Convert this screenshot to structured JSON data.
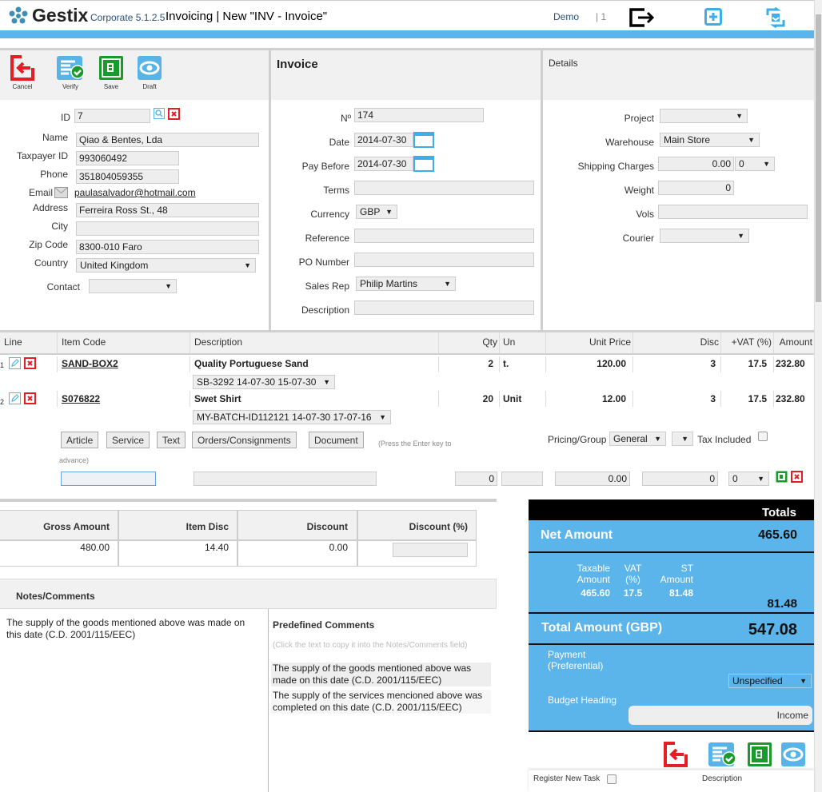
{
  "header": {
    "brand": "Gestix",
    "version": "Corporate 5.1.2.5",
    "title": "Invoicing | New \"INV - Invoice\"",
    "user": "Demo",
    "session": "| 1",
    "icons": [
      "logout-icon",
      "new-window-icon",
      "refresh-icon"
    ]
  },
  "toolbar": {
    "cancel": "Cancel",
    "verify": "Verify",
    "save": "Save",
    "draft": "Draft"
  },
  "customer": {
    "id_label": "ID",
    "id": "7",
    "name_label": "Name",
    "name": "Qiao & Bentes, Lda",
    "taxpayer_label": "Taxpayer ID",
    "taxpayer": "993060492",
    "phone_label": "Phone",
    "phone": "351804059355",
    "email_label": "Email",
    "email": "paulasalvador@hotmail.com",
    "address_label": "Address",
    "address": "Ferreira Ross St., 48",
    "city_label": "City",
    "city": "",
    "zip_label": "Zip Code",
    "zip": "8300-010 Faro",
    "country_label": "Country",
    "country": "United Kingdom",
    "contact_label": "Contact",
    "contact": ""
  },
  "invoice": {
    "heading": "Invoice",
    "number_label": "Nº",
    "number": "174",
    "date_label": "Date",
    "date": "2014-07-30",
    "pay_before_label": "Pay Before",
    "pay_before": "2014-07-30",
    "terms_label": "Terms",
    "terms": "",
    "currency_label": "Currency",
    "currency": "GBP",
    "reference_label": "Reference",
    "reference": "",
    "po_label": "PO Number",
    "po": "",
    "sales_rep_label": "Sales Rep",
    "sales_rep": "Philip Martins",
    "description_label": "Description",
    "description": ""
  },
  "details": {
    "heading": "Details",
    "project_label": "Project",
    "project": "",
    "warehouse_label": "Warehouse",
    "warehouse": "Main Store",
    "shipping_label": "Shipping Charges",
    "shipping": "0.00",
    "shipping_tax": "0",
    "weight_label": "Weight",
    "weight": "0",
    "vols_label": "Vols",
    "vols": "",
    "courier_label": "Courier",
    "courier": ""
  },
  "lines": {
    "headers": [
      "Line",
      "Item Code",
      "Description",
      "Qty",
      "Un",
      "Unit Price",
      "Disc",
      "+VAT (%)",
      "Amount"
    ],
    "rows": [
      {
        "line": "1",
        "code": "SAND-BOX2",
        "description": "Quality Portuguese Sand",
        "batch": "SB-3292 14-07-30 15-07-30",
        "qty": "2",
        "un": "t.",
        "price": "120.00",
        "disc": "3",
        "vat": "17.5",
        "amount": "232.80"
      },
      {
        "line": "2",
        "code": "S076822",
        "description": "Swet Shirt",
        "batch": "MY-BATCH-ID112121 14-07-30 17-07-16",
        "qty": "20",
        "un": "Unit",
        "price": "12.00",
        "disc": "3",
        "vat": "17.5",
        "amount": "232.80"
      }
    ],
    "add_buttons": [
      "Article",
      "Service",
      "Text",
      "Orders/Consignments",
      "Document"
    ],
    "hint": "(Press the Enter key to advance)",
    "pricing_label": "Pricing/Group",
    "pricing": "General",
    "pricing2": "",
    "tax_included_label": "Tax Included",
    "new_line": {
      "code": "",
      "description": "",
      "qty": "0",
      "un": "",
      "price": "0.00",
      "disc": "0",
      "vat": "0"
    }
  },
  "summary": {
    "headers": [
      "Gross Amount",
      "Item Disc",
      "Discount",
      "Discount (%)"
    ],
    "values": [
      "480.00",
      "14.40",
      "0.00",
      ""
    ]
  },
  "notes": {
    "heading": "Notes/Comments",
    "text": "The supply of the goods mentioned above was made on this date (C.D. 2001/115/EEC)",
    "predefined_heading": "Predefined Comments",
    "predefined_hint": "(Click the text to copy it into the Notes/Comments field)",
    "predefined": [
      "The supply of the goods mentioned above was made on this date (C.D. 2001/115/EEC)",
      "The supply of the services mencioned above was completed on this date (C.D. 2001/115/EEC)"
    ]
  },
  "totals": {
    "heading": "Totals",
    "net_label": "Net Amount",
    "net": "465.60",
    "tax_headers": [
      "Taxable Amount",
      "VAT (%)",
      "ST Amount"
    ],
    "tax_values": [
      "465.60",
      "17.5",
      "81.48"
    ],
    "tax_total": "81.48",
    "total_label": "Total Amount (GBP)",
    "total": "547.08",
    "payment_label": "Payment (Preferential)",
    "payment": "Unspecified",
    "budget_label": "Budget Heading",
    "budget": "Income"
  },
  "footer": {
    "register_task_label": "Register New Task",
    "description_label": "Description"
  },
  "colors": {
    "accent": "#5bb4ea",
    "danger": "#e31e24",
    "success": "#1a9a2a"
  }
}
